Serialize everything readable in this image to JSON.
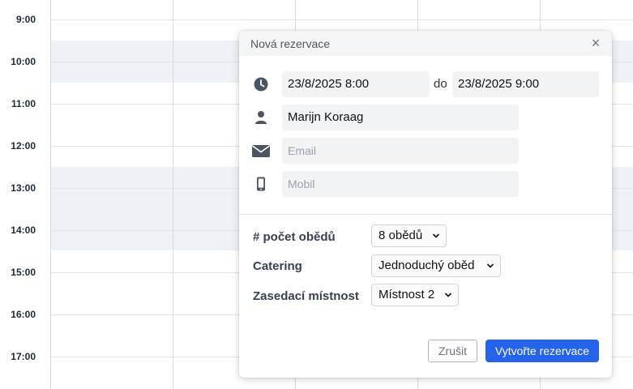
{
  "calendar": {
    "times": [
      "9:00",
      "10:00",
      "11:00",
      "12:00",
      "13:00",
      "14:00",
      "15:00",
      "16:00",
      "17:00"
    ]
  },
  "dialog": {
    "title": "Nová rezervace",
    "close_label": "×",
    "start_datetime": "23/8/2025  8:00",
    "separator": "do",
    "end_datetime": "23/8/2025  9:00",
    "name_value": "Marijn Koraag",
    "email_placeholder": "Email",
    "mobile_placeholder": "Mobil",
    "meals_label": "# počet obědů",
    "meals_value": "8 obědů",
    "catering_label": "Catering",
    "catering_value": "Jednoduchý oběd",
    "room_label": "Zasedací místnost",
    "room_value": "Místnost 2",
    "cancel_label": "Zrušit",
    "create_label": "Vytvořte rezervace"
  },
  "colors": {
    "primary": "#2563eb",
    "icon": "#4b5563",
    "shade": "#eef2f6"
  },
  "icons": [
    "clock-icon",
    "person-icon",
    "envelope-icon",
    "mobile-icon",
    "chevron-down-icon",
    "close-icon"
  ]
}
